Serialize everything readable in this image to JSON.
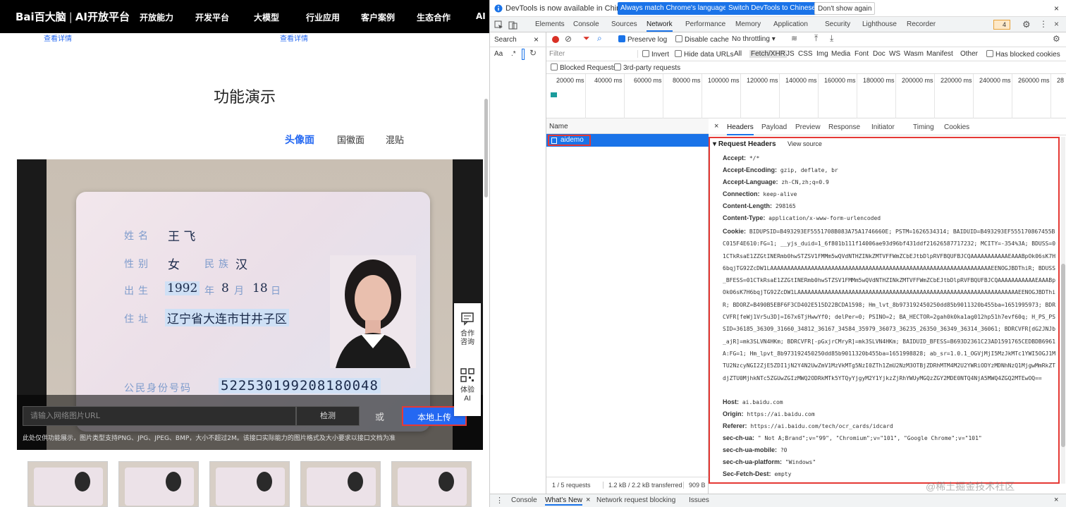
{
  "left": {
    "logo_brand": "Bai百大脑",
    "logo_divider": "|",
    "logo_product": "AI开放平台",
    "nav": [
      "开放能力",
      "开发平台",
      "大模型",
      "行业应用",
      "客户案例",
      "生态合作",
      "AI"
    ],
    "details": [
      "查看详情",
      "查看详情"
    ],
    "demo_title": "功能演示",
    "tabs": [
      "头像面",
      "国徽面",
      "混贴"
    ],
    "card": {
      "name_label": "姓名",
      "name": "王 飞",
      "gender_label": "性别",
      "gender": "女",
      "nation_label": "民族",
      "nation": "汉",
      "birth_label": "出生",
      "birth_year": "1992",
      "year_unit": "年",
      "birth_month": "8",
      "month_unit": "月",
      "birth_day": "18",
      "day_unit": "日",
      "address_label": "住址",
      "address": "辽宁省大连市甘井子区",
      "id_label": "公民身份号码",
      "id_number": "522530199208180048"
    },
    "url_placeholder": "请输入网络图片URL",
    "detect": "检测",
    "or": "或",
    "local_upload": "本地上传",
    "note": "此处仅供功能展示，图片类型支持PNG、JPG、JPEG、BMP，大小不超过2M。该接口实际能力的图片格式及大小要求以接口文档为准",
    "float_items": [
      {
        "icon": "chat-icon",
        "label": "合作咨询"
      },
      {
        "icon": "qr-icon",
        "label": "体验AI"
      }
    ]
  },
  "devtools": {
    "info_msg": "DevTools is now available in Chinese!",
    "info_btn1": "Always match Chrome's language",
    "info_btn2": "Switch DevTools to Chinese",
    "info_btn3": "Don't show again",
    "tabs": [
      "Elements",
      "Console",
      "Sources",
      "Network",
      "Performance",
      "Memory",
      "Application",
      "Security",
      "Lighthouse",
      "Recorder"
    ],
    "issues_count": "4",
    "search_label": "Search",
    "search_aa": "Aa",
    "search_dot": ".*",
    "preserve_log": "Preserve log",
    "disable_cache": "Disable cache",
    "throttling": "No throttling",
    "filter_placeholder": "Filter",
    "invert": "Invert",
    "hide_data_urls": "Hide data URLs",
    "filter_types": [
      "All",
      "Fetch/XHR",
      "JS",
      "CSS",
      "Img",
      "Media",
      "Font",
      "Doc",
      "WS",
      "Wasm",
      "Manifest",
      "Other"
    ],
    "has_blocked_cookies": "Has blocked cookies",
    "blocked_requests": "Blocked Requests",
    "third_party": "3rd-party requests",
    "timeline_ticks": [
      "20000 ms",
      "40000 ms",
      "60000 ms",
      "80000 ms",
      "100000 ms",
      "120000 ms",
      "140000 ms",
      "160000 ms",
      "180000 ms",
      "200000 ms",
      "220000 ms",
      "240000 ms",
      "260000 ms",
      "28"
    ],
    "name_header": "Name",
    "request_name": "aidemo",
    "status": "1 / 5 requests",
    "transferred": "1.2 kB / 2.2 kB transferred",
    "status_more": "909 B",
    "detail_tabs": [
      "Headers",
      "Payload",
      "Preview",
      "Response",
      "Initiator",
      "Timing",
      "Cookies"
    ],
    "section_title": "Request Headers",
    "view_source": "View source",
    "headers": [
      {
        "k": "Accept:",
        "v": "*/*"
      },
      {
        "k": "Accept-Encoding:",
        "v": "gzip, deflate, br"
      },
      {
        "k": "Accept-Language:",
        "v": "zh-CN,zh;q=0.9"
      },
      {
        "k": "Connection:",
        "v": "keep-alive"
      },
      {
        "k": "Content-Length:",
        "v": "298165"
      },
      {
        "k": "Content-Type:",
        "v": "application/x-www-form-urlencoded"
      }
    ],
    "cookie_key": "Cookie:",
    "cookie_value": "BIDUPSID=B493293EF5551708B083A75A1746660E; PSTM=1626534314; BAIDUID=B493293EF555170867455BC015F4E610:FG=1; __yjs_duid=1_6f801b111f14006ae93d96bf431ddf21626587717232; MCITY=-354%3A; BDUSS=01CTkRsaE1ZZGtINERmb0hwSTZSV1FMMm5wQVdNTHZINkZMTVFFWmZCbEJtbDlpRVFBQUFBJCQAAAAAAAAAAAEAAABpOk06sK7H6bqjTG92ZcDW1LAAAAAAAAAAAAAAAAAAAAAAAAAAAAAAAAAAAAAAAAAAAAAAAAAAAAAAAAAAAAAAAAAEENOGJBDThiR; BDUSS_BFESS=01CTkRsaE1ZZGtINERmb0hwSTZSV1FMMm5wQVdNTHZINkZMTVFFWmZCbEJtbDlpRVFBQUFBJCQAAAAAAAAAAAEAAABpOk06sK7H6bqjTG92ZcDW1LAAAAAAAAAAAAAAAAAAAAAAAAAAAAAAAAAAAAAAAAAAAAAAAAAAAAAAAAAAAAAAAAAEENOGJBDThiR; BDORZ=B490B5EBF6F3CD402E515D22BCDA1598; Hm_lvt_8b973192450250dd85b9011320b455ba=1651995973; BDRCVFR[feWj1Vr5u3D]=I67x6TjHwwYf0; delPer=0; PSINO=2; BA_HECTOR=2gah0k0ka1ag012hp51h7evf60q; H_PS_PSSID=36185_36309_31660_34812_36167_34584_35979_36073_36235_26350_36349_36314_36061; BDRCVFR[dG2JNJb_ajR]=mk3SLVN4HKm; BDRCVFR[-pGxjrCMryR]=mk3SLVN4HKm; BAIDUID_BFESS=B693D2361C23AD1591765CEDBDB6961A:FG=1; Hm_lpvt_8b973192450250dd85b9011320b455ba=1651998828; ab_sr=1.0.1_OGVjMjI5MzJkMTc1YWI5OGJ1MTU2NzcyNGI2ZjE5ZDI1jN2Y4N2UwZmV1MzVkMTg5NzI0ZTh1ZmU2NzM3OTBjZDRhMTM4M2U2YWRiODYzMDNhNzQ1MjgwMmRkZTdjZTU0MjhkNTc5ZGUwZGIzMWQ2ODRkMTk5YTQyYjgyM2Y1YjkzZjRhYWUyMGQzZGY2MDE0NTQ4NjA5MWQ4ZGQ2MTEwOQ==",
    "headers2": [
      {
        "k": "Host:",
        "v": "ai.baidu.com"
      },
      {
        "k": "Origin:",
        "v": "https://ai.baidu.com"
      },
      {
        "k": "Referer:",
        "v": "https://ai.baidu.com/tech/ocr_cards/idcard"
      },
      {
        "k": "sec-ch-ua:",
        "v": "\" Not A;Brand\";v=\"99\", \"Chromium\";v=\"101\", \"Google Chrome\";v=\"101\""
      },
      {
        "k": "sec-ch-ua-mobile:",
        "v": "?0"
      },
      {
        "k": "sec-ch-ua-platform:",
        "v": "\"Windows\""
      },
      {
        "k": "Sec-Fetch-Dest:",
        "v": "empty"
      }
    ],
    "drawer_tabs": [
      "Console",
      "What's New",
      "Network request blocking",
      "Issues"
    ],
    "watermark": "@稀土掘金技术社区"
  }
}
